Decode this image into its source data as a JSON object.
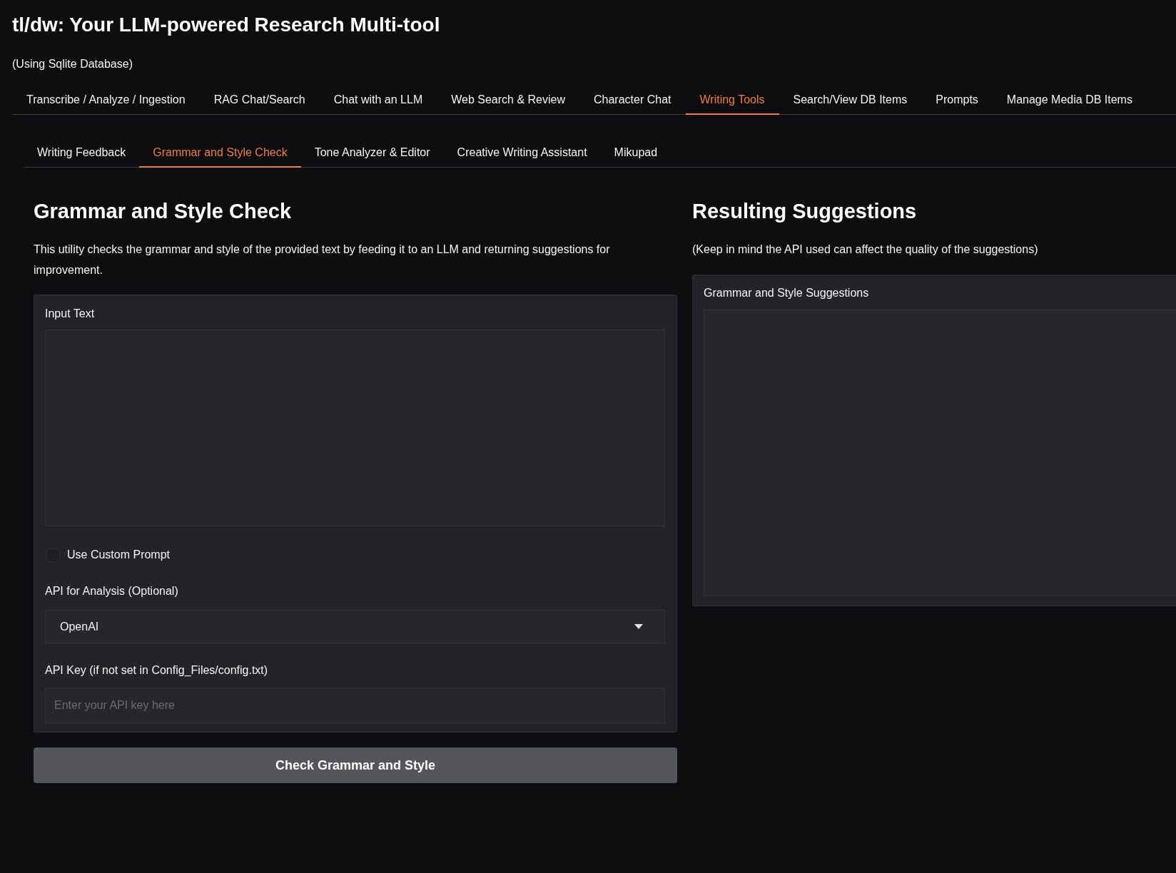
{
  "app": {
    "title": "tl/dw: Your LLM-powered Research Multi-tool",
    "subtitle": "(Using Sqlite Database)"
  },
  "main_tabs": [
    {
      "label": "Transcribe / Analyze / Ingestion",
      "selected": false
    },
    {
      "label": "RAG Chat/Search",
      "selected": false
    },
    {
      "label": "Chat with an LLM",
      "selected": false
    },
    {
      "label": "Web Search & Review",
      "selected": false
    },
    {
      "label": "Character Chat",
      "selected": false
    },
    {
      "label": "Writing Tools",
      "selected": true
    },
    {
      "label": "Search/View DB Items",
      "selected": false
    },
    {
      "label": "Prompts",
      "selected": false
    },
    {
      "label": "Manage Media DB Items",
      "selected": false
    }
  ],
  "sub_tabs": [
    {
      "label": "Writing Feedback",
      "selected": false
    },
    {
      "label": "Grammar and Style Check",
      "selected": true
    },
    {
      "label": "Tone Analyzer & Editor",
      "selected": false
    },
    {
      "label": "Creative Writing Assistant",
      "selected": false
    },
    {
      "label": "Mikupad",
      "selected": false
    }
  ],
  "grammar_panel": {
    "heading": "Grammar and Style Check",
    "description": "This utility checks the grammar and style of the provided text by feeding it to an LLM and returning suggestions for improvement.",
    "input_text": {
      "label": "Input Text"
    },
    "custom_prompt": {
      "label": "Use Custom Prompt",
      "checked": false
    },
    "api_select": {
      "label": "API for Analysis (Optional)",
      "value": "OpenAI"
    },
    "api_key": {
      "label": "API Key (if not set in Config_Files/config.txt)",
      "placeholder": "Enter your API key here"
    },
    "submit_button": "Check Grammar and Style"
  },
  "results_panel": {
    "heading": "Resulting Suggestions",
    "note": "(Keep in mind the API used can affect the quality of the suggestions)",
    "output": {
      "label": "Grammar and Style Suggestions"
    }
  }
}
